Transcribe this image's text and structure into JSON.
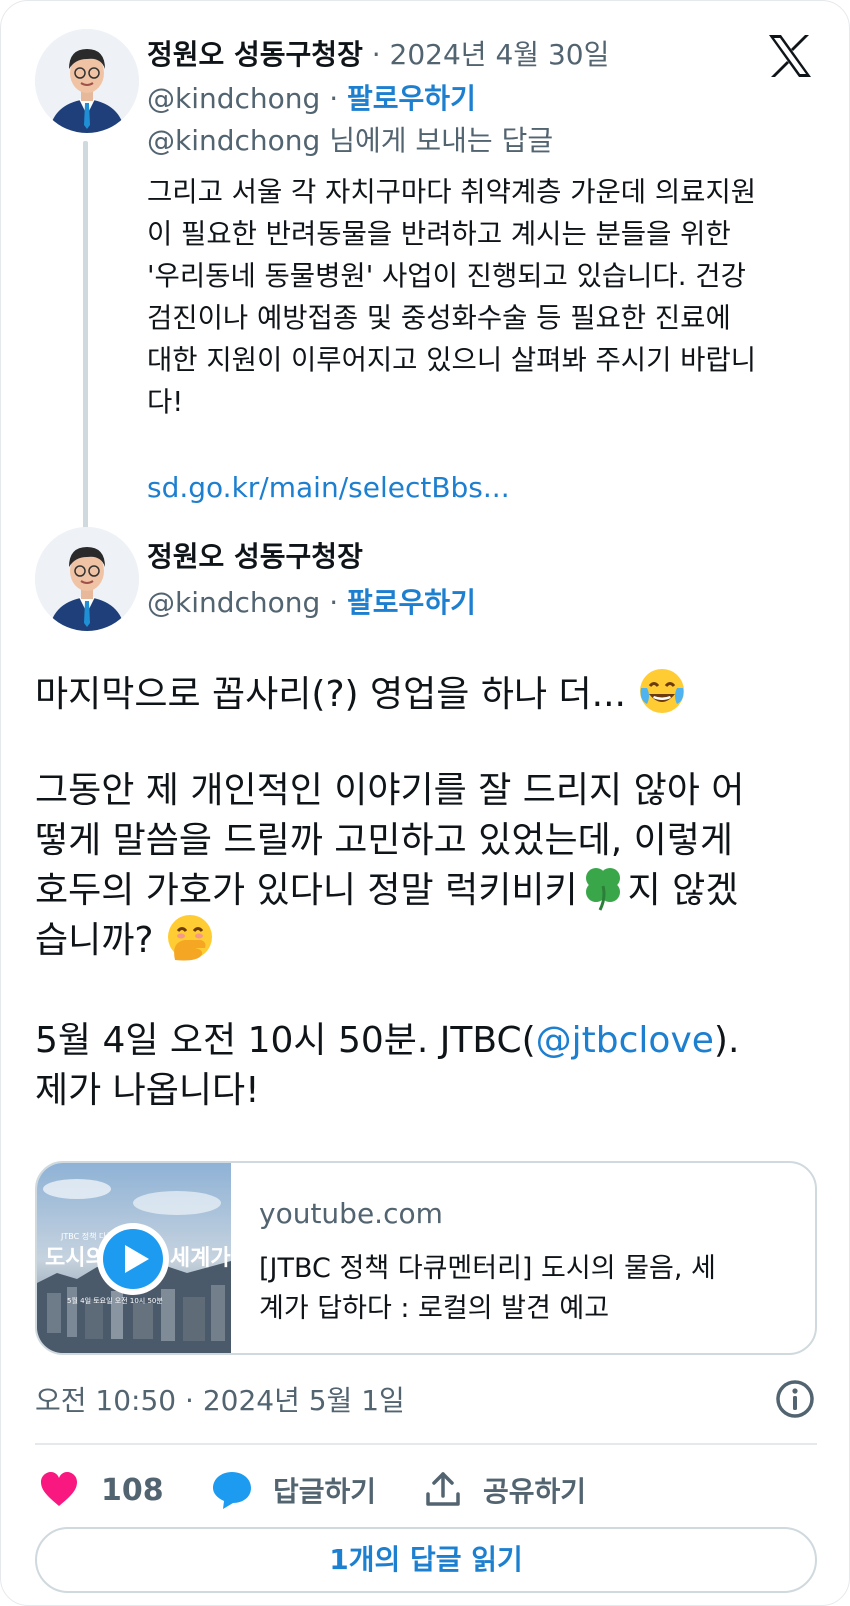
{
  "reply_tweet": {
    "author_name": "정원오 성동구청장",
    "date": "· 2024년 4월 30일",
    "handle": "@kindchong",
    "separator": "·",
    "follow_label": "팔로우하기",
    "replying_to": "@kindchong 님에게 보내는 답글",
    "body_lines": [
      "그리고 서울 각 자치구마다 취약계층 가운데 의료지원",
      "이 필요한 반려동물을 반려하고 계시는 분들을 위한",
      "'우리동네 동물병원' 사업이 진행되고 있습니다. 건강",
      "검진이나 예방접종 및 중성화수술 등 필요한 진료에",
      "대한 지원이 이루어지고 있으니 살펴봐 주시기 바랍니",
      "다!"
    ],
    "link": "sd.go.kr/main/selectBbs..."
  },
  "main_tweet": {
    "author_name": "정원오 성동구청장",
    "handle": "@kindchong",
    "separator": "·",
    "follow_label": "팔로우하기",
    "line1": "마지막으로 꼽사리(?) 영업을 하나 더...",
    "line2": "그동안 제 개인적인 이야기를 잘 드리지 않아 어",
    "line3": "떻게 말씀을 드릴까 고민하고 있었는데, 이렇게",
    "line4a": "호두의 가호가 있다니 정말 럭키비키",
    "line4b": "지 않겠",
    "line5": "습니까?",
    "line6a": "5월 4일 오전 10시 50분. JTBC(",
    "line6_mention": "@jtbclove",
    "line6b": ").",
    "line7": "제가 나옵니다!",
    "emojis": [
      "face-with-tears-of-joy",
      "four-leaf-clover",
      "face-with-hand-over-mouth"
    ]
  },
  "link_card": {
    "domain": "youtube.com",
    "title_lines": [
      "[JTBC 정책 다큐멘터리] 도시의 물음, 세",
      "계가 답하다 : 로컬의 발견 예고"
    ],
    "thumbnail_text": "도시의 물음, 세계가 답하다",
    "thumbnail_caption": "5월 4일 토요일 오전 10시 50분",
    "thumbnail_small": "JTBC 정책 다큐멘터리"
  },
  "meta": {
    "timestamp": "오전 10:50 · 2024년 5월 1일"
  },
  "actions": {
    "like_count": "108",
    "reply_label": "답글하기",
    "share_label": "공유하기"
  },
  "read_replies_label": "1개의 답글 읽기",
  "colors": {
    "accent": "#1d7fcf",
    "like": "#f91880",
    "text": "#0f1419",
    "muted": "#536471",
    "border": "#cfd9de"
  },
  "icons": [
    "x-logo-icon",
    "heart-icon",
    "reply-bubble-icon",
    "share-icon",
    "info-icon",
    "play-icon"
  ]
}
